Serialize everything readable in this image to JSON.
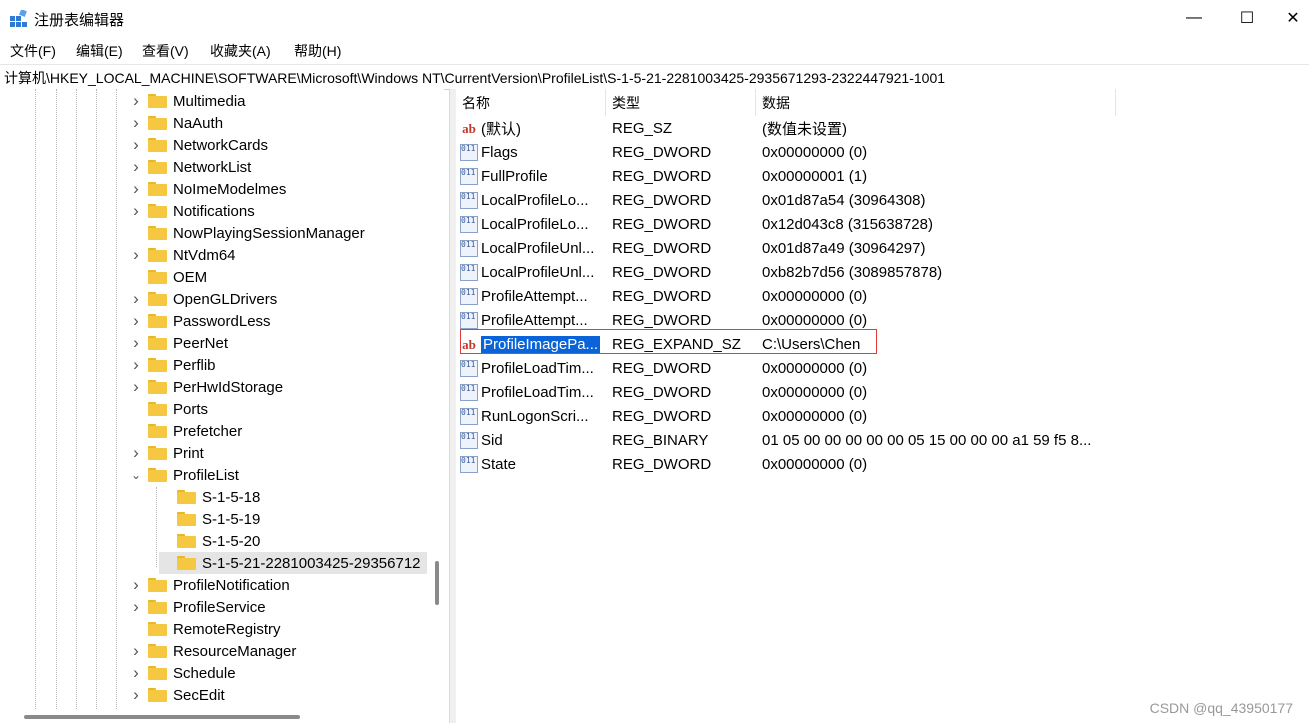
{
  "window": {
    "title": "注册表编辑器",
    "icon": "regedit-icon",
    "controls": {
      "minimize": "—",
      "maximize": "☐",
      "close": "✕"
    }
  },
  "menu": {
    "file": "文件(F)",
    "edit": "编辑(E)",
    "view": "查看(V)",
    "favorites": "收藏夹(A)",
    "help": "帮助(H)"
  },
  "address": "计算机\\HKEY_LOCAL_MACHINE\\SOFTWARE\\Microsoft\\Windows NT\\CurrentVersion\\ProfileList\\S-1-5-21-2281003425-2935671293-2322447921-1001",
  "tree": {
    "items": [
      {
        "label": "Multimedia",
        "level": 0,
        "expander": "collapsed"
      },
      {
        "label": "NaAuth",
        "level": 0,
        "expander": "collapsed"
      },
      {
        "label": "NetworkCards",
        "level": 0,
        "expander": "collapsed"
      },
      {
        "label": "NetworkList",
        "level": 0,
        "expander": "collapsed"
      },
      {
        "label": "NoImeModelmes",
        "level": 0,
        "expander": "collapsed"
      },
      {
        "label": "Notifications",
        "level": 0,
        "expander": "collapsed"
      },
      {
        "label": "NowPlayingSessionManager",
        "level": 0,
        "expander": "none"
      },
      {
        "label": "NtVdm64",
        "level": 0,
        "expander": "collapsed"
      },
      {
        "label": "OEM",
        "level": 0,
        "expander": "none"
      },
      {
        "label": "OpenGLDrivers",
        "level": 0,
        "expander": "collapsed"
      },
      {
        "label": "PasswordLess",
        "level": 0,
        "expander": "collapsed"
      },
      {
        "label": "PeerNet",
        "level": 0,
        "expander": "collapsed"
      },
      {
        "label": "Perflib",
        "level": 0,
        "expander": "collapsed"
      },
      {
        "label": "PerHwIdStorage",
        "level": 0,
        "expander": "collapsed"
      },
      {
        "label": "Ports",
        "level": 0,
        "expander": "none"
      },
      {
        "label": "Prefetcher",
        "level": 0,
        "expander": "none"
      },
      {
        "label": "Print",
        "level": 0,
        "expander": "collapsed"
      },
      {
        "label": "ProfileList",
        "level": 0,
        "expander": "expanded"
      },
      {
        "label": "S-1-5-18",
        "level": 1,
        "expander": "none"
      },
      {
        "label": "S-1-5-19",
        "level": 1,
        "expander": "none"
      },
      {
        "label": "S-1-5-20",
        "level": 1,
        "expander": "none"
      },
      {
        "label": "S-1-5-21-2281003425-29356712",
        "level": 1,
        "expander": "none",
        "selected": true
      },
      {
        "label": "ProfileNotification",
        "level": 0,
        "expander": "collapsed"
      },
      {
        "label": "ProfileService",
        "level": 0,
        "expander": "collapsed"
      },
      {
        "label": "RemoteRegistry",
        "level": 0,
        "expander": "none"
      },
      {
        "label": "ResourceManager",
        "level": 0,
        "expander": "collapsed"
      },
      {
        "label": "Schedule",
        "level": 0,
        "expander": "collapsed"
      },
      {
        "label": "SecEdit",
        "level": 0,
        "expander": "collapsed"
      }
    ]
  },
  "list": {
    "columns": {
      "name": "名称",
      "type": "类型",
      "data": "数据"
    },
    "rows": [
      {
        "name": "(默认)",
        "type": "REG_SZ",
        "data": "(数值未设置)",
        "icon": "string"
      },
      {
        "name": "Flags",
        "type": "REG_DWORD",
        "data": "0x00000000 (0)",
        "icon": "binary"
      },
      {
        "name": "FullProfile",
        "type": "REG_DWORD",
        "data": "0x00000001 (1)",
        "icon": "binary"
      },
      {
        "name": "LocalProfileLo...",
        "type": "REG_DWORD",
        "data": "0x01d87a54 (30964308)",
        "icon": "binary"
      },
      {
        "name": "LocalProfileLo...",
        "type": "REG_DWORD",
        "data": "0x12d043c8 (315638728)",
        "icon": "binary"
      },
      {
        "name": "LocalProfileUnl...",
        "type": "REG_DWORD",
        "data": "0x01d87a49 (30964297)",
        "icon": "binary"
      },
      {
        "name": "LocalProfileUnl...",
        "type": "REG_DWORD",
        "data": "0xb82b7d56 (3089857878)",
        "icon": "binary"
      },
      {
        "name": "ProfileAttempt...",
        "type": "REG_DWORD",
        "data": "0x00000000 (0)",
        "icon": "binary"
      },
      {
        "name": "ProfileAttempt...",
        "type": "REG_DWORD",
        "data": "0x00000000 (0)",
        "icon": "binary"
      },
      {
        "name": "ProfileImagePa...",
        "type": "REG_EXPAND_SZ",
        "data": "C:\\Users\\Chen",
        "icon": "string",
        "selected": true
      },
      {
        "name": "ProfileLoadTim...",
        "type": "REG_DWORD",
        "data": "0x00000000 (0)",
        "icon": "binary"
      },
      {
        "name": "ProfileLoadTim...",
        "type": "REG_DWORD",
        "data": "0x00000000 (0)",
        "icon": "binary"
      },
      {
        "name": "RunLogonScri...",
        "type": "REG_DWORD",
        "data": "0x00000000 (0)",
        "icon": "binary"
      },
      {
        "name": "Sid",
        "type": "REG_BINARY",
        "data": "01 05 00 00 00 00 00 05 15 00 00 00 a1 59 f5 8...",
        "icon": "binary"
      },
      {
        "name": "State",
        "type": "REG_DWORD",
        "data": "0x00000000 (0)",
        "icon": "binary"
      }
    ]
  },
  "colors": {
    "selection": "#0a64d8",
    "highlight_box": "#e23b3b",
    "folder": "#f6c842"
  },
  "watermark": "CSDN @qq_43950177"
}
